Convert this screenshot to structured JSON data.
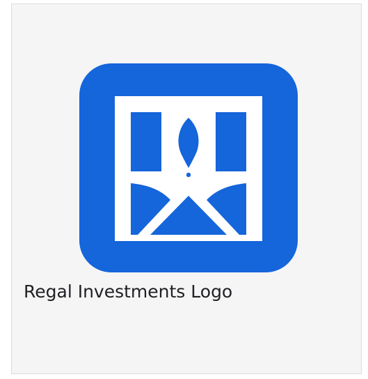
{
  "card": {
    "caption": "Regal Investments Logo"
  },
  "logo": {
    "icon": "regal-investments-logo-icon",
    "background_color": "#1565db",
    "foreground_color": "#ffffff"
  }
}
